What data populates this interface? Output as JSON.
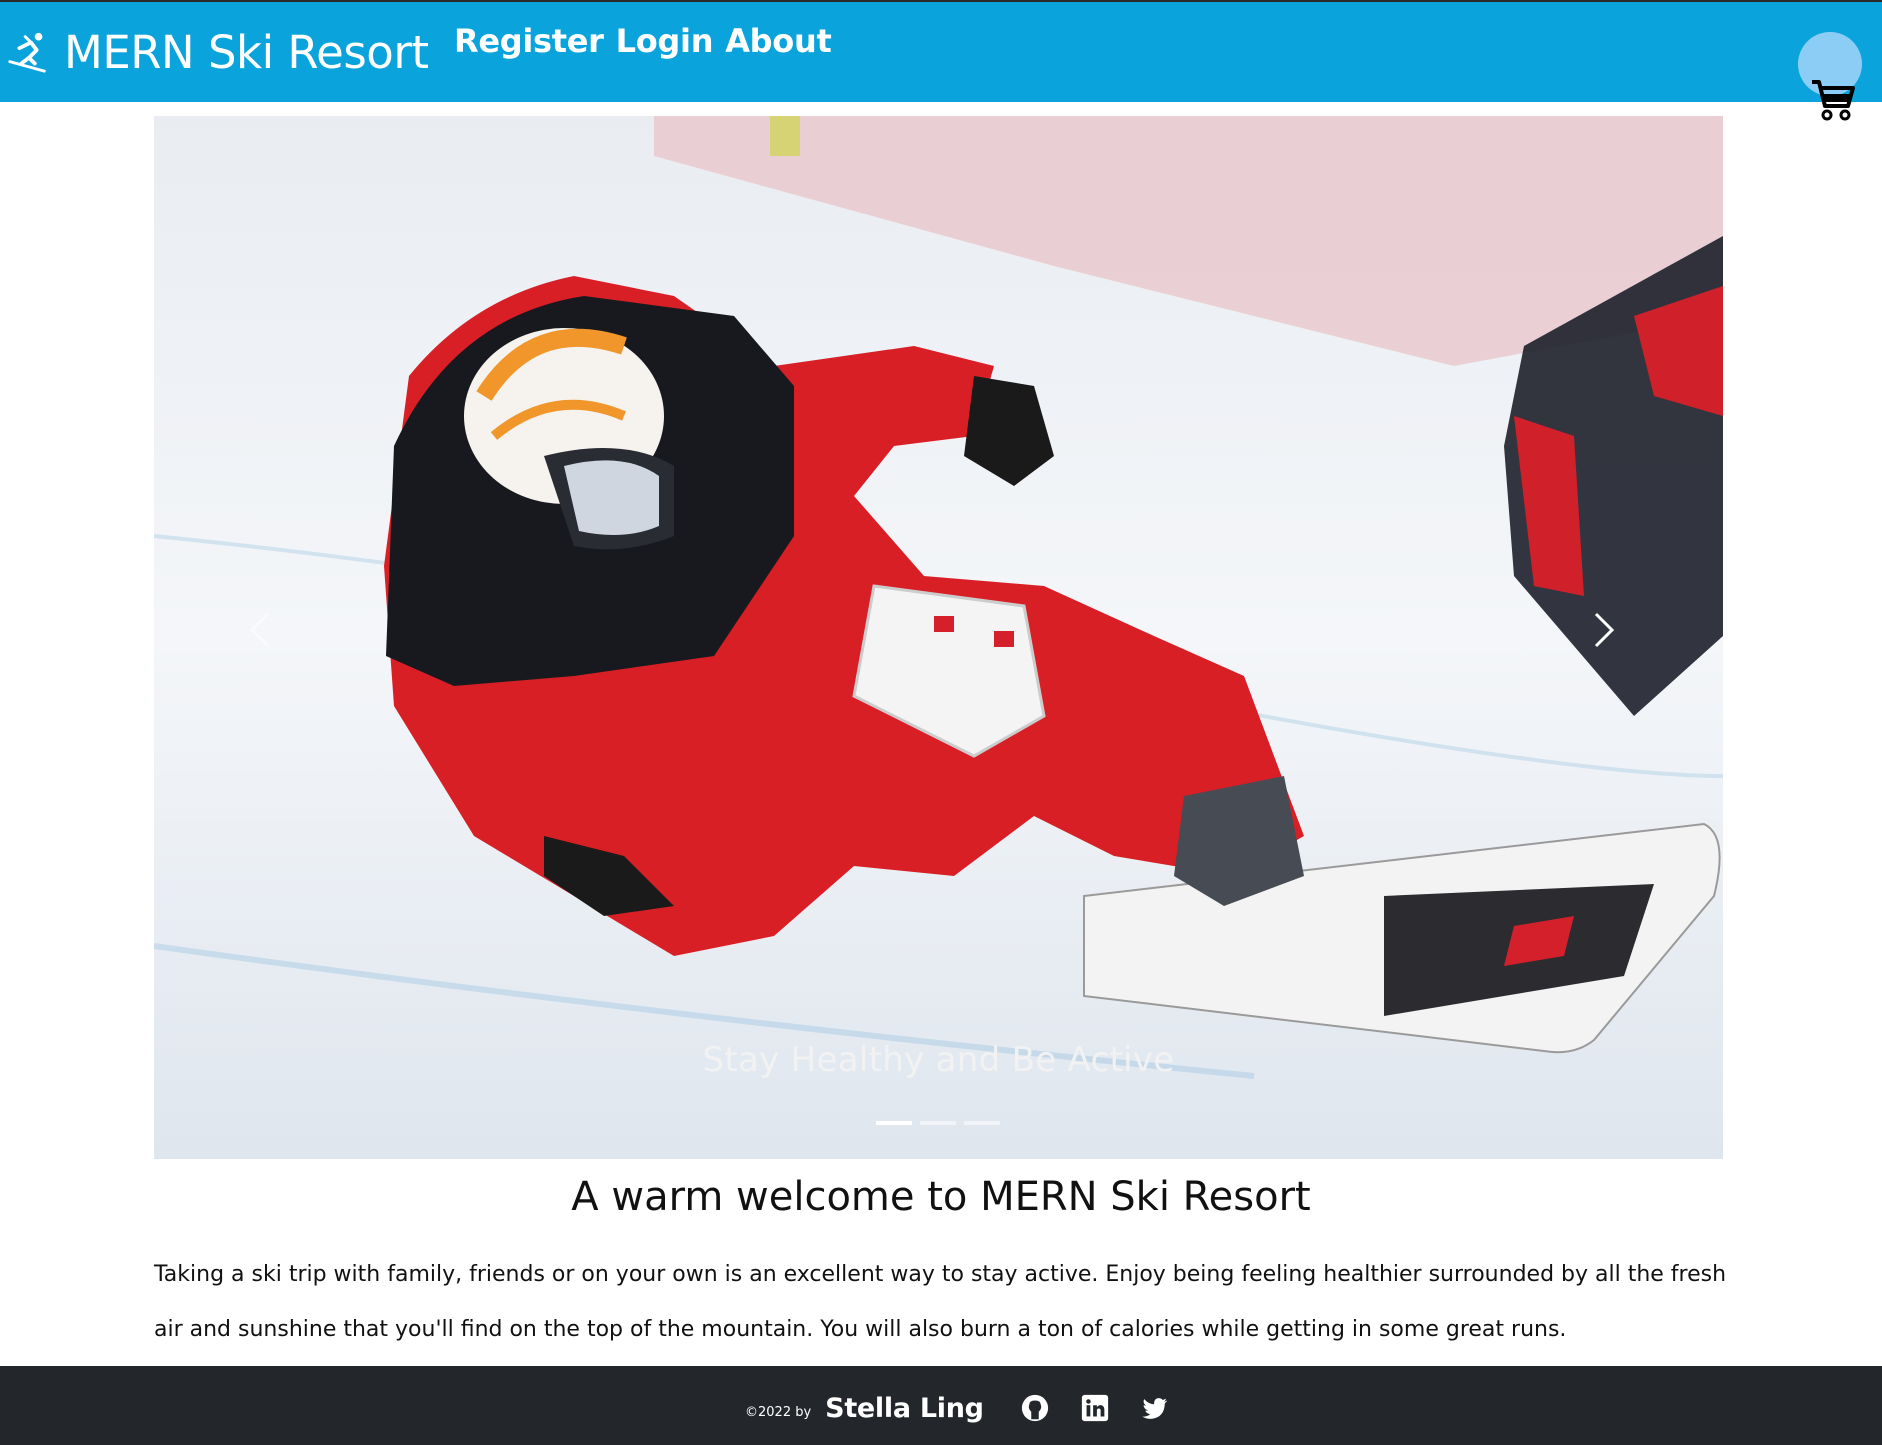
{
  "navbar": {
    "brand": "MERN Ski Resort",
    "links": [
      "Register",
      "Login",
      "About"
    ],
    "bg_color": "#0aa3dc",
    "brand_icon": "skier-icon",
    "cart_icon": "cart-icon"
  },
  "carousel": {
    "caption": "Stay Healthy and Be Active",
    "slide_count": 3,
    "active_slide": 1,
    "prev_icon": "chevron-left-icon",
    "next_icon": "chevron-right-icon"
  },
  "welcome": {
    "title": "A warm welcome to MERN Ski Resort",
    "body": "Taking a ski trip with family, friends or on your own is an excellent way to stay active. Enjoy being feeling healthier surrounded by all the fresh air and sunshine that you'll find on the top of the mountain. You will also burn a ton of calories while getting in some great runs."
  },
  "footer": {
    "copyright": "©2022 by",
    "author": "Stella Ling",
    "social_icons": [
      "github-icon",
      "linkedin-icon",
      "twitter-icon"
    ],
    "bg_color": "#23272b"
  }
}
